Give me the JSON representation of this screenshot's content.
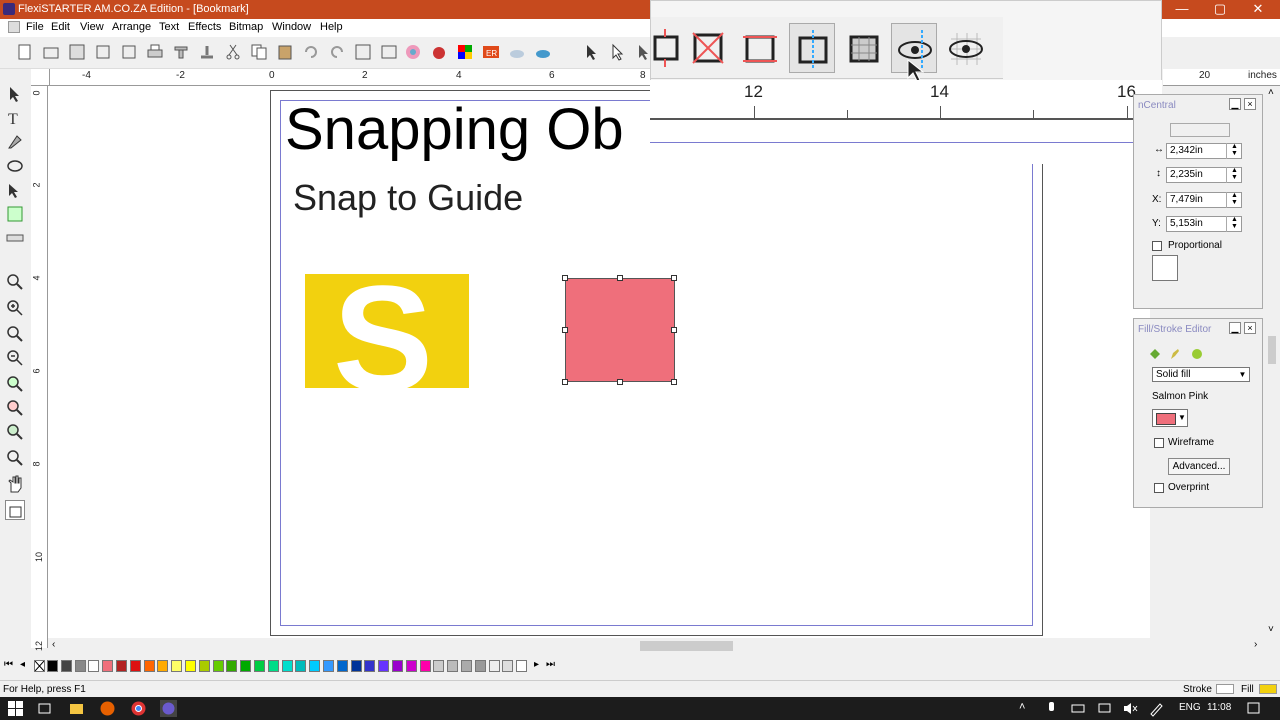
{
  "window": {
    "title": "FlexiSTARTER AM.CO.ZA Edition - [Bookmark]",
    "minimize": "—",
    "maximize": "▢",
    "close": "✕"
  },
  "menu": [
    "File",
    "Edit",
    "View",
    "Arrange",
    "Text",
    "Effects",
    "Bitmap",
    "Window",
    "Help"
  ],
  "ruler": {
    "h_labels": [
      "-4",
      "-2",
      "0",
      "2",
      "4",
      "6",
      "8"
    ],
    "v_labels": [
      "0",
      "2",
      "4",
      "6",
      "8",
      "10",
      "12"
    ],
    "snap_labels": [
      "12",
      "14",
      "16"
    ],
    "right_labels": [
      "20"
    ],
    "units": "inches"
  },
  "canvas": {
    "title": "Snapping Ob",
    "subtitle": "Snap to Guide",
    "logo_letter": "S"
  },
  "panel_transform": {
    "title": "nCentral",
    "width": "2,342in",
    "height": "2,235in",
    "x_label": "X:",
    "x": "7,479in",
    "y_label": "Y:",
    "y": "5,153in",
    "proportional": "Proportional"
  },
  "panel_fill": {
    "title": "Fill/Stroke Editor",
    "fill_type": "Solid fill",
    "color_name": "Salmon Pink",
    "color": "#ef6f7b",
    "wireframe": "Wireframe",
    "advanced": "Advanced...",
    "overprint": "Overprint"
  },
  "status": {
    "help": "For Help, press F1",
    "stroke": "Stroke",
    "fill": "Fill"
  },
  "taskbar": {
    "lang": "ENG",
    "time": "11:08"
  },
  "palette_colors": [
    "#000000",
    "#444444",
    "#888888",
    "#ffffff",
    "#ef6f7b",
    "#b22222",
    "#dd1111",
    "#ff6600",
    "#ffaa00",
    "#ffff66",
    "#ffff00",
    "#aacc00",
    "#66cc00",
    "#33aa00",
    "#00aa00",
    "#00cc44",
    "#00dd88",
    "#00ddcc",
    "#00bbbb",
    "#00ccff",
    "#3399ff",
    "#0066cc",
    "#003399",
    "#3333cc",
    "#6633ff",
    "#9900cc",
    "#cc00cc",
    "#ff00aa",
    "#cccccc",
    "#bbbbbb",
    "#aaaaaa",
    "#999999",
    "#eeeeee",
    "#dddddd",
    "#ffffff"
  ]
}
